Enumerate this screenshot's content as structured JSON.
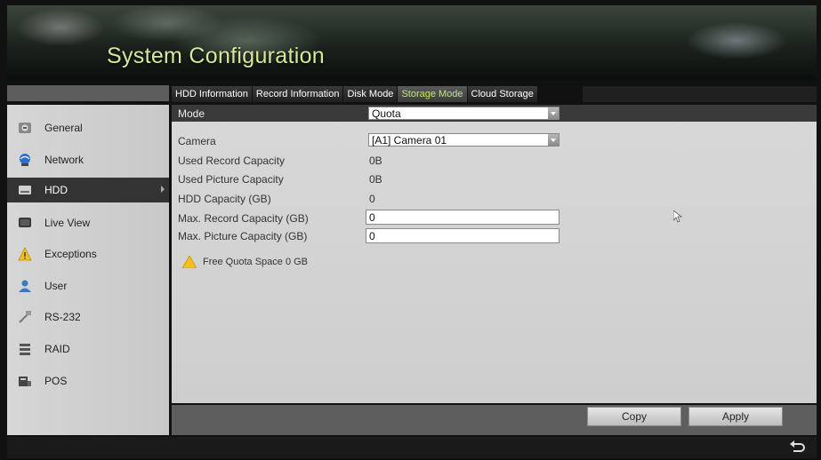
{
  "header": {
    "title": "System Configuration"
  },
  "sidebar": {
    "items": [
      {
        "label": "General",
        "icon": "general-icon"
      },
      {
        "label": "Network",
        "icon": "network-icon"
      },
      {
        "label": "HDD",
        "icon": "hdd-icon",
        "active": true
      },
      {
        "label": "Live View",
        "icon": "live-view-icon"
      },
      {
        "label": "Exceptions",
        "icon": "warning-icon"
      },
      {
        "label": "User",
        "icon": "user-icon"
      },
      {
        "label": "RS-232",
        "icon": "rs232-icon"
      },
      {
        "label": "RAID",
        "icon": "raid-icon"
      },
      {
        "label": "POS",
        "icon": "pos-icon"
      }
    ]
  },
  "tabs": [
    {
      "label": "HDD Information"
    },
    {
      "label": "Record Information"
    },
    {
      "label": "Disk Mode"
    },
    {
      "label": "Storage Mode",
      "active": true
    },
    {
      "label": "Cloud Storage"
    }
  ],
  "form": {
    "mode_label": "Mode",
    "mode_value": "Quota",
    "camera_label": "Camera",
    "camera_value": "[A1] Camera 01",
    "used_record_label": "Used Record Capacity",
    "used_record_value": "0B",
    "used_picture_label": "Used Picture Capacity",
    "used_picture_value": "0B",
    "hdd_capacity_label": "HDD Capacity (GB)",
    "hdd_capacity_value": "0",
    "max_record_label": "Max. Record Capacity (GB)",
    "max_record_value": "0",
    "max_picture_label": "Max. Picture Capacity (GB)",
    "max_picture_value": "0",
    "free_quota_text": "Free Quota Space 0 GB"
  },
  "buttons": {
    "copy": "Copy",
    "apply": "Apply"
  },
  "colors": {
    "accent": "#c4e27a",
    "title": "#d7e89a",
    "warning": "#f2c21b"
  }
}
